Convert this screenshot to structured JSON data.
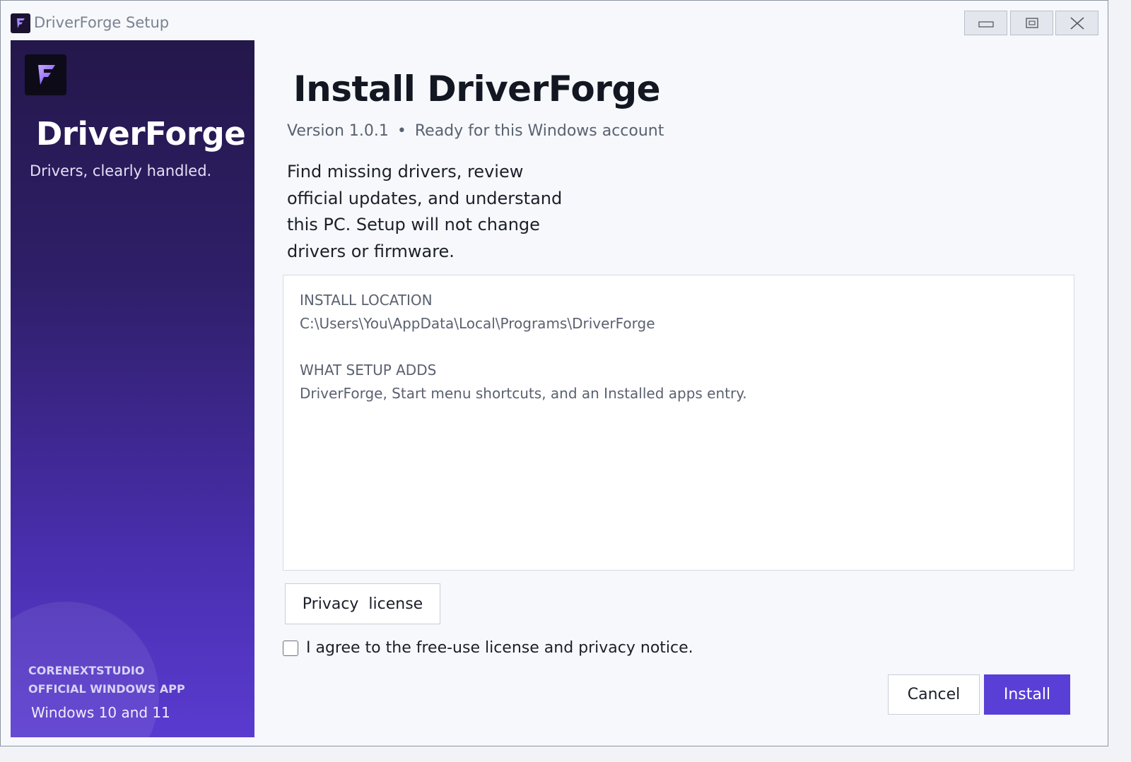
{
  "window": {
    "title": "DriverForge Setup"
  },
  "sidebar": {
    "brand": "DriverForge",
    "tagline": "Drivers, clearly handled.",
    "company_line1": "CORENEXTSTUDIO",
    "company_line2": "OFFICIAL WINDOWS APP",
    "os": "Windows 10 and 11"
  },
  "main": {
    "title": "Install DriverForge",
    "version": "Version 1.0.1",
    "separator": "•",
    "status": "Ready for this Windows account",
    "description": "Find missing drivers, review official updates, and understand this PC. Setup will not change drivers or firmware.",
    "install_location_label": "INSTALL LOCATION",
    "install_location_value": "C:\\Users\\You\\AppData\\Local\\Programs\\DriverForge",
    "adds_label": "WHAT SETUP ADDS",
    "adds_value": "DriverForge, Start menu shortcuts, and an Installed apps entry.",
    "privacy_button": "Privacy  license",
    "agree_text": "I agree to the free-use license and privacy notice.",
    "agree_checked": false,
    "cancel_button": "Cancel",
    "install_button": "Install"
  },
  "colors": {
    "accent": "#5a3fd6",
    "sidebar_top": "#24174a",
    "sidebar_bottom": "#5a3bd0"
  },
  "icons": {
    "app": "forge-f-logo-icon",
    "minimize": "minimize-icon",
    "maximize": "maximize-icon",
    "close": "close-icon"
  }
}
